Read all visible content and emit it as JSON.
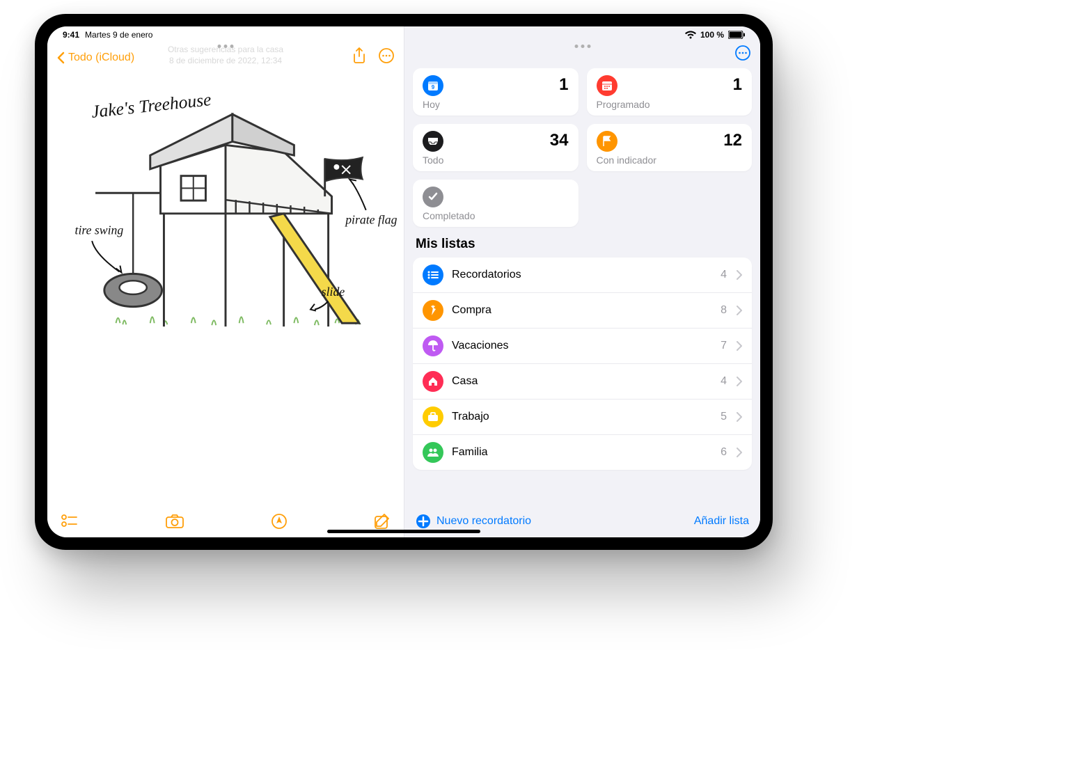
{
  "status": {
    "time": "9:41",
    "date": "Martes 9 de enero",
    "battery": "100 %"
  },
  "notes": {
    "back_label": "Todo (iCloud)",
    "title_ghost_line1": "Otras sugerencias para la casa",
    "title_ghost_line2": "8 de diciembre de 2022, 12:34",
    "drawing": {
      "title_text": "Jake's Treehouse",
      "annotation_tire": "tire swing",
      "annotation_flag": "pirate flag",
      "annotation_slide": "slide"
    }
  },
  "reminders": {
    "smart": [
      {
        "label": "Hoy",
        "count": "1",
        "icon": "calendar-today",
        "bg": "#007aff"
      },
      {
        "label": "Programado",
        "count": "1",
        "icon": "calendar",
        "bg": "#ff3b30"
      },
      {
        "label": "Todo",
        "count": "34",
        "icon": "tray",
        "bg": "#1c1c1e"
      },
      {
        "label": "Con indicador",
        "count": "12",
        "icon": "flag",
        "bg": "#ff9500"
      },
      {
        "label": "Completado",
        "count": "",
        "icon": "check",
        "bg": "#8e8e93"
      }
    ],
    "section_title": "Mis listas",
    "lists": [
      {
        "label": "Recordatorios",
        "count": "4",
        "bg": "#007aff",
        "icon": "list"
      },
      {
        "label": "Compra",
        "count": "8",
        "bg": "#ff9500",
        "icon": "carrot"
      },
      {
        "label": "Vacaciones",
        "count": "7",
        "bg": "#bf5af2",
        "icon": "umbrella"
      },
      {
        "label": "Casa",
        "count": "4",
        "bg": "#ff2d55",
        "icon": "house"
      },
      {
        "label": "Trabajo",
        "count": "5",
        "bg": "#ffcc00",
        "icon": "briefcase"
      },
      {
        "label": "Familia",
        "count": "6",
        "bg": "#34c759",
        "icon": "people"
      }
    ],
    "new_reminder": "Nuevo recordatorio",
    "add_list": "Añadir lista"
  }
}
